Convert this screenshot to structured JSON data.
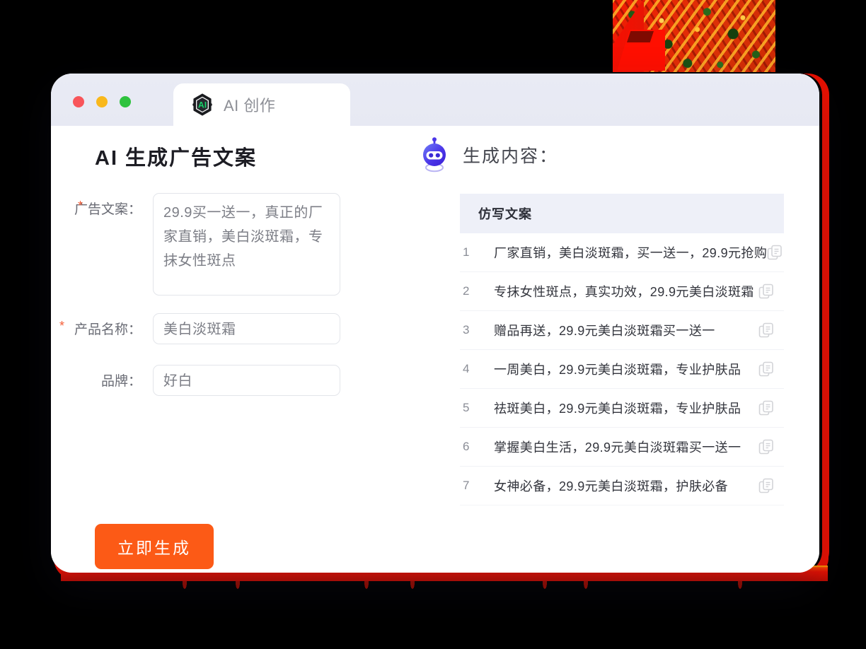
{
  "window": {
    "traffic_lights": [
      {
        "name": "close",
        "color": "#f8555a"
      },
      {
        "name": "minimize",
        "color": "#f9b81c"
      },
      {
        "name": "maximize",
        "color": "#2ec23e"
      }
    ],
    "tab": {
      "label": "AI 创作",
      "icon": "ai-hexagon-logo",
      "icon_text": "AI",
      "icon_accent": "#19d36b"
    }
  },
  "left_pane": {
    "title": "AI 生成广告文案",
    "fields": [
      {
        "label": "广告文案：",
        "required": true,
        "required_marker": "*",
        "type": "textarea",
        "value": "29.9买一送一，真正的厂家直销，美白淡斑霜，专抹女性斑点"
      },
      {
        "label": "产品名称：",
        "required": true,
        "required_marker": "*",
        "type": "input",
        "value": "美白淡斑霜"
      },
      {
        "label": "品牌：",
        "required": false,
        "required_marker": "",
        "type": "input",
        "value": "好白"
      }
    ],
    "submit_button": {
      "label": "立即生成",
      "color": "#fc5a16"
    }
  },
  "right_pane": {
    "heading": "生成内容：",
    "heading_icon": "robot-icon",
    "table": {
      "column_header": "仿写文案",
      "copy_icon": "copy-icon",
      "rows": [
        {
          "index": "1",
          "text": "厂家直销，美白淡斑霜，买一送一，29.9元抢购"
        },
        {
          "index": "2",
          "text": "专抹女性斑点，真实功效，29.9元美白淡斑霜"
        },
        {
          "index": "3",
          "text": "赠品再送，29.9元美白淡斑霜买一送一"
        },
        {
          "index": "4",
          "text": "一周美白，29.9元美白淡斑霜，专业护肤品"
        },
        {
          "index": "5",
          "text": "祛斑美白，29.9元美白淡斑霜，专业护肤品"
        },
        {
          "index": "6",
          "text": "掌握美白生活，29.9元美白淡斑霜买一送一"
        },
        {
          "index": "7",
          "text": "女神必备，29.9元美白淡斑霜，护肤必备"
        }
      ]
    }
  },
  "theme": {
    "background": "#000000",
    "card_background": "#ffffff",
    "titlebar_background": "#e8eaf3",
    "table_header_background": "#eef0f8",
    "accent_orange": "#fc5a16",
    "required_star": "#f5603a",
    "decor_red": "#e81000"
  }
}
